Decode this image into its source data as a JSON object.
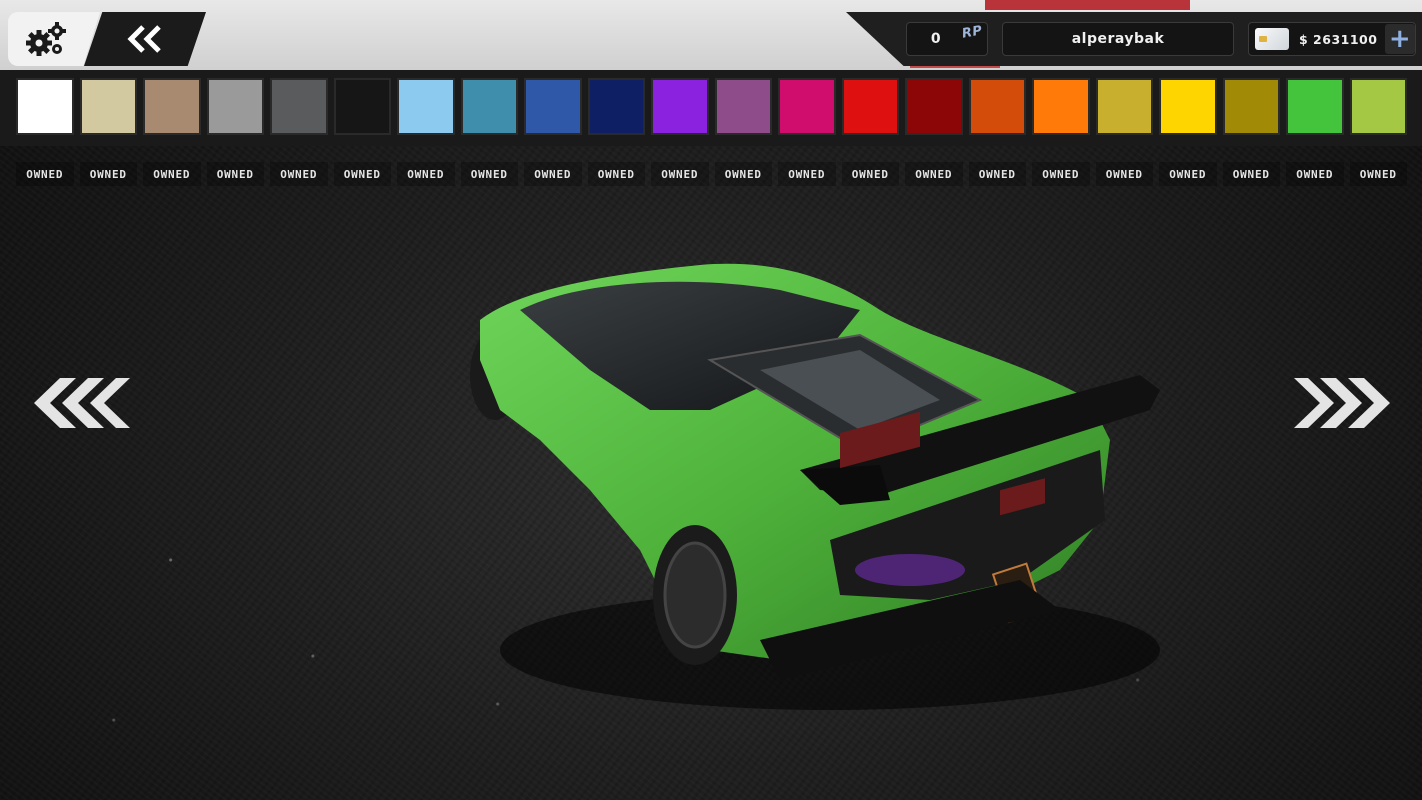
{
  "hud": {
    "rp_value": "0",
    "rp_label": "RP",
    "username": "alperaybak",
    "money": "$ 2631100",
    "add_money_symbol": "+"
  },
  "icons": {
    "settings": "gears-icon",
    "back": "double-chevron-left-icon",
    "prev": "triple-chevron-left-icon",
    "next": "triple-chevron-right-icon",
    "card": "credit-card-icon"
  },
  "colors": [
    {
      "hex": "#ffffff",
      "status": "Owned"
    },
    {
      "hex": "#d3c9a0",
      "status": "Owned"
    },
    {
      "hex": "#a88a70",
      "status": "Owned"
    },
    {
      "hex": "#9a9a9a",
      "status": "Owned"
    },
    {
      "hex": "#595b5d",
      "status": "Owned"
    },
    {
      "hex": "#161616",
      "status": "Owned"
    },
    {
      "hex": "#8ccbef",
      "status": "Owned"
    },
    {
      "hex": "#3f8eab",
      "status": "Owned"
    },
    {
      "hex": "#2f58a8",
      "status": "Owned"
    },
    {
      "hex": "#0e1f63",
      "status": "Owned"
    },
    {
      "hex": "#8a22e0",
      "status": "Owned"
    },
    {
      "hex": "#8f4c8a",
      "status": "Owned"
    },
    {
      "hex": "#d00c6c",
      "status": "Owned"
    },
    {
      "hex": "#de1010",
      "status": "Owned"
    },
    {
      "hex": "#8c0608",
      "status": "Owned"
    },
    {
      "hex": "#d34c0a",
      "status": "Owned"
    },
    {
      "hex": "#ff7a08",
      "status": "Owned"
    },
    {
      "hex": "#c8b02e",
      "status": "Owned"
    },
    {
      "hex": "#ffd500",
      "status": "Owned"
    },
    {
      "hex": "#a18a05",
      "status": "Owned"
    },
    {
      "hex": "#44c43c",
      "status": "Owned"
    },
    {
      "hex": "#a4c844",
      "status": "Owned"
    }
  ],
  "car": {
    "body_color": "#4fb33b"
  }
}
